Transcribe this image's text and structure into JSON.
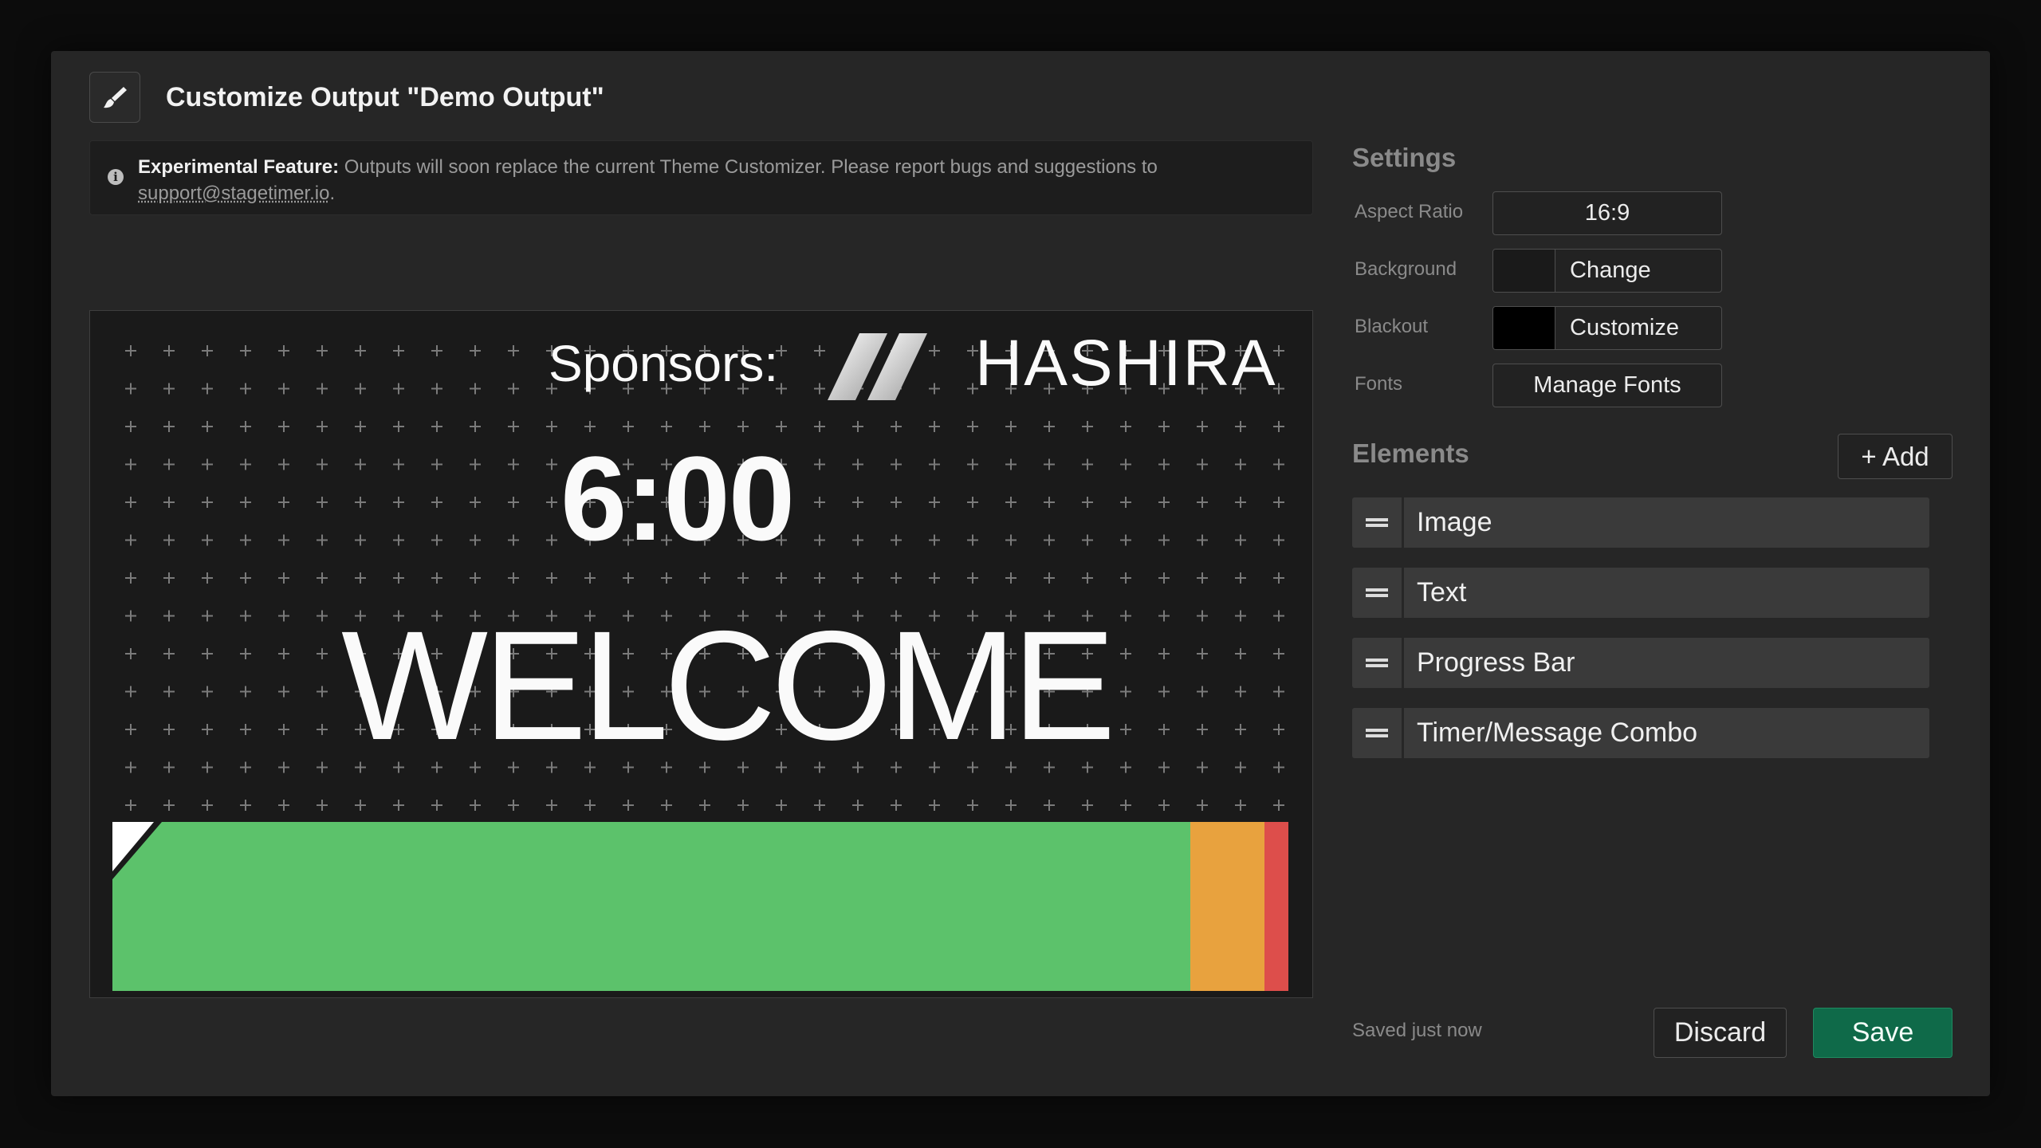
{
  "dialog": {
    "title": "Customize Output \"Demo Output\""
  },
  "notice": {
    "label": "Experimental Feature:",
    "message": " Outputs will soon replace the current Theme Customizer. Please report bugs and suggestions to ",
    "link": "support@stagetimer.io",
    "suffix": "."
  },
  "preview": {
    "sponsors_label": "Sponsors:",
    "logo_text": "HASHIRA",
    "timer": "6:00",
    "message": "WELCOME",
    "progress_segments": [
      {
        "name": "green",
        "fraction": 0.9,
        "color": "#5cc26b"
      },
      {
        "name": "orange",
        "fraction": 0.062,
        "color": "#e8a23e"
      },
      {
        "name": "red",
        "fraction": 0.02,
        "color": "#dd4e4b"
      }
    ],
    "background_color": "#1a1a1a"
  },
  "settings": {
    "heading": "Settings",
    "aspect_ratio_label": "Aspect Ratio",
    "aspect_ratio_value": "16:9",
    "background_label": "Background",
    "background_button": "Change",
    "background_color": "#1a1a1a",
    "blackout_label": "Blackout",
    "blackout_button": "Customize",
    "blackout_color": "#000000",
    "fonts_label": "Fonts",
    "fonts_button": "Manage Fonts"
  },
  "elements": {
    "heading": "Elements",
    "add_label": "+ Add",
    "items": [
      {
        "label": "Image"
      },
      {
        "label": "Text"
      },
      {
        "label": "Progress Bar"
      },
      {
        "label": "Timer/Message Combo"
      }
    ]
  },
  "footer": {
    "status": "Saved just now",
    "discard_label": "Discard",
    "save_label": "Save"
  },
  "colors": {
    "accent_save": "#0f6a49",
    "panel": "#262626"
  }
}
